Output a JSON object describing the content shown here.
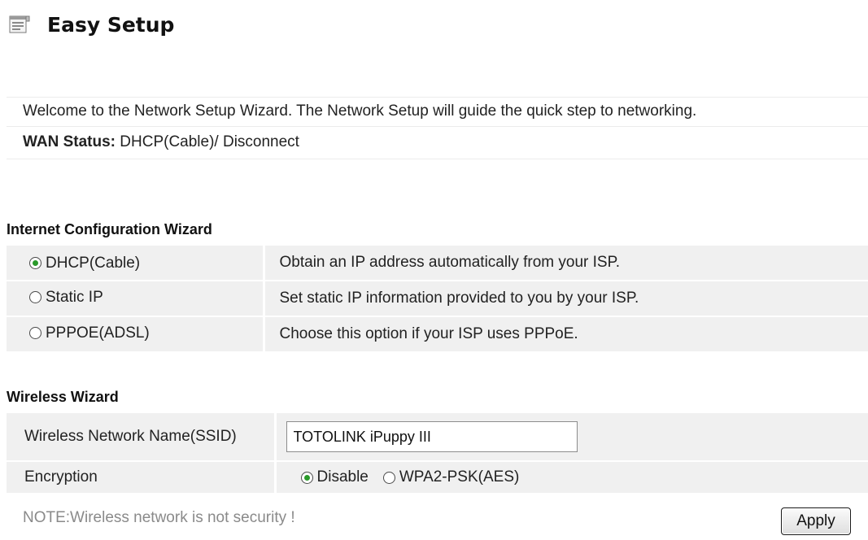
{
  "header": {
    "icon": "wizard-list-icon",
    "title": "Easy Setup"
  },
  "welcome": {
    "message": "Welcome to the Network Setup Wizard. The Network Setup will guide the quick step to networking.",
    "wan_label": "WAN Status:",
    "wan_value": " DHCP(Cable)/ Disconnect"
  },
  "internet_wizard": {
    "title": "Internet Configuration Wizard",
    "options": [
      {
        "label": "DHCP(Cable)",
        "description": "Obtain an IP address automatically from your ISP.",
        "selected": true
      },
      {
        "label": "Static IP",
        "description": "Set static IP information provided to you by your ISP.",
        "selected": false
      },
      {
        "label": "PPPOE(ADSL)",
        "description": "Choose this option if your ISP uses PPPoE.",
        "selected": false
      }
    ]
  },
  "wireless_wizard": {
    "title": "Wireless Wizard",
    "ssid_label": "Wireless Network Name(SSID)",
    "ssid_value": "TOTOLINK iPuppy III",
    "encryption_label": "Encryption",
    "encryption_options": [
      {
        "label": "Disable",
        "selected": true
      },
      {
        "label": "WPA2-PSK(AES)",
        "selected": false
      }
    ]
  },
  "footer": {
    "note": "NOTE:Wireless network is not security !",
    "apply_label": "Apply"
  },
  "colors": {
    "row_background": "#f0f0f0",
    "radio_selected": "#2a9a2a",
    "note_text": "#8a8a8a"
  }
}
